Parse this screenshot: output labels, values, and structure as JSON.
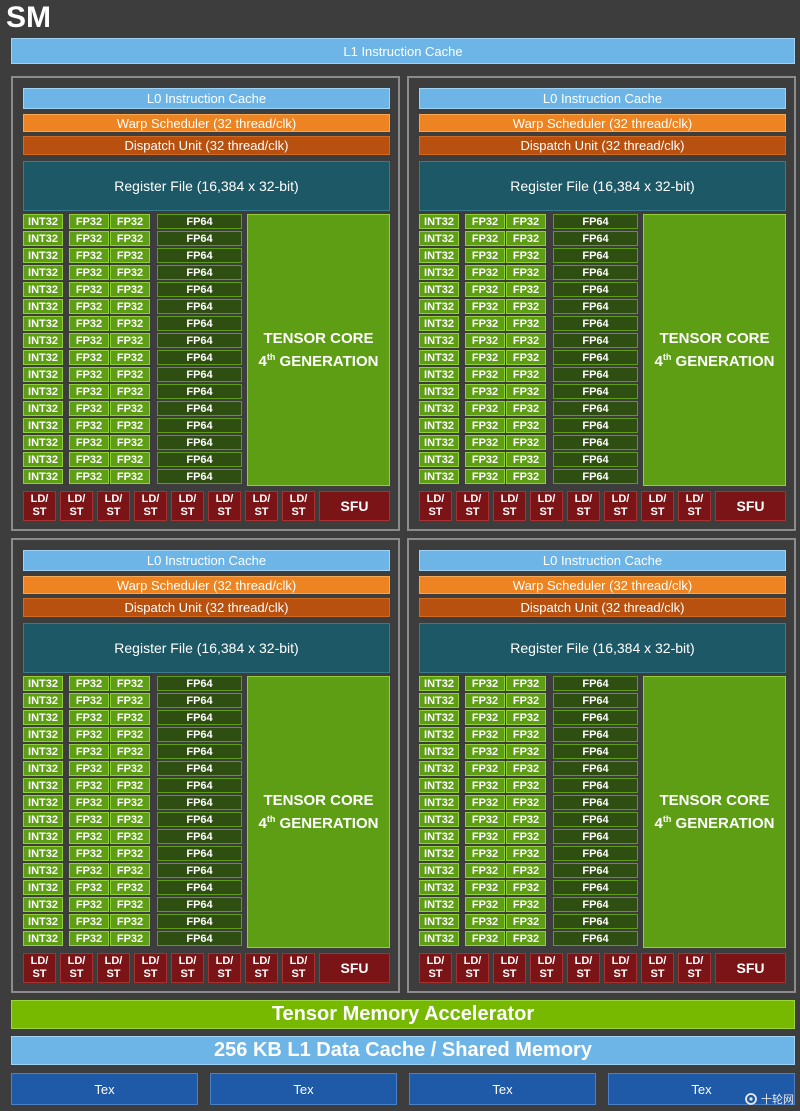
{
  "title": "SM",
  "l1_instruction_cache": "L1 Instruction Cache",
  "partition": {
    "l0_cache": "L0 Instruction Cache",
    "warp_scheduler": "Warp Scheduler (32 thread/clk)",
    "dispatch_unit": "Dispatch Unit (32 thread/clk)",
    "register_file": "Register File (16,384 x 32-bit)",
    "int32": "INT32",
    "fp32": "FP32",
    "fp64": "FP64",
    "tensor_core_line1": "TENSOR CORE",
    "tensor_core_num": "4",
    "tensor_core_sup": "th",
    "tensor_core_line2": "GENERATION",
    "ld": "LD/",
    "st": "ST",
    "sfu": "SFU"
  },
  "tensor_memory_accelerator": "Tensor Memory Accelerator",
  "l1_data_cache": "256 KB L1 Data Cache / Shared Memory",
  "tex_units": [
    "Tex",
    "Tex",
    "Tex",
    "Tex"
  ],
  "watermark": "十轮网",
  "colors": {
    "background": "#3d3d3d",
    "cache_blue": "#6cb5e6",
    "warp_orange": "#ee8421",
    "dispatch_brown": "#b8510f",
    "register_teal": "#1c5866",
    "core_green": "#5e9e14",
    "fp64_dark_green": "#2f4e12",
    "ldst_red": "#7a1416",
    "tma_green": "#76b900",
    "tex_blue": "#1e5aa8"
  }
}
